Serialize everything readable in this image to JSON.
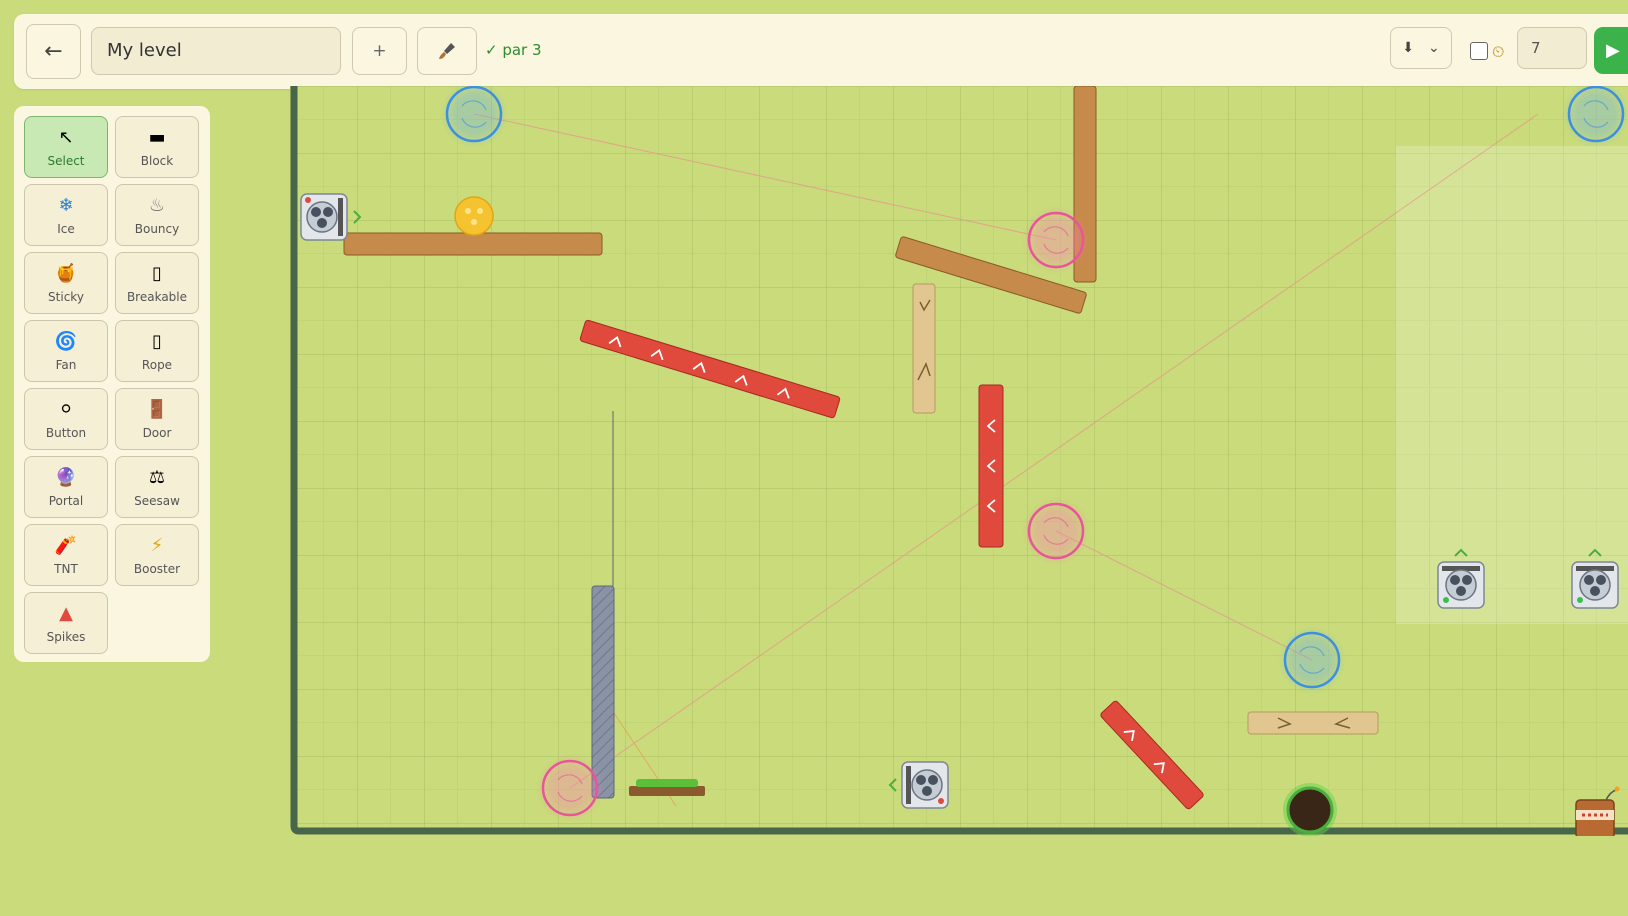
{
  "header": {
    "back_label": "←",
    "level_name": "My level",
    "add_label": "+",
    "par_text": "✓ par 3",
    "direction_value": "⬇",
    "direction_caret": "⌄",
    "timer_icon": "⏲",
    "time_value": "7",
    "play_label": "▶"
  },
  "tools": [
    {
      "label": "Select",
      "icon": "↖",
      "icon_name": "cursor-icon",
      "active": true
    },
    {
      "label": "Block",
      "icon": "▬",
      "icon_name": "block-icon"
    },
    {
      "label": "Ice",
      "icon": "❄",
      "icon_name": "snowflake-icon"
    },
    {
      "label": "Bouncy",
      "icon": "♨",
      "icon_name": "bouncy-icon"
    },
    {
      "label": "Sticky",
      "icon": "🍯",
      "icon_name": "honey-icon"
    },
    {
      "label": "Breakable",
      "icon": "▯",
      "icon_name": "breakable-icon"
    },
    {
      "label": "Fan",
      "icon": "🌀",
      "icon_name": "fan-icon"
    },
    {
      "label": "Rope",
      "icon": "▯",
      "icon_name": "rope-icon"
    },
    {
      "label": "Button",
      "icon": "⚪",
      "icon_name": "button-icon"
    },
    {
      "label": "Door",
      "icon": "🚪",
      "icon_name": "door-icon"
    },
    {
      "label": "Portal",
      "icon": "🔮",
      "icon_name": "portal-icon"
    },
    {
      "label": "Seesaw",
      "icon": "⚖",
      "icon_name": "seesaw-icon"
    },
    {
      "label": "TNT",
      "icon": "🧨",
      "icon_name": "tnt-icon"
    },
    {
      "label": "Booster",
      "icon": "⚡",
      "icon_name": "booster-icon"
    },
    {
      "label": "Spikes",
      "icon": "▲",
      "icon_name": "spikes-icon"
    }
  ],
  "colors": {
    "grass": "#c9db7a",
    "panel": "#fbf6e0",
    "wall": "#48664a",
    "wood": "#c68a4a",
    "booster_red": "#e04a3c",
    "portal_blue": "#3d8fe0",
    "portal_pink": "#e8559a",
    "play_green": "#3bb34a"
  }
}
